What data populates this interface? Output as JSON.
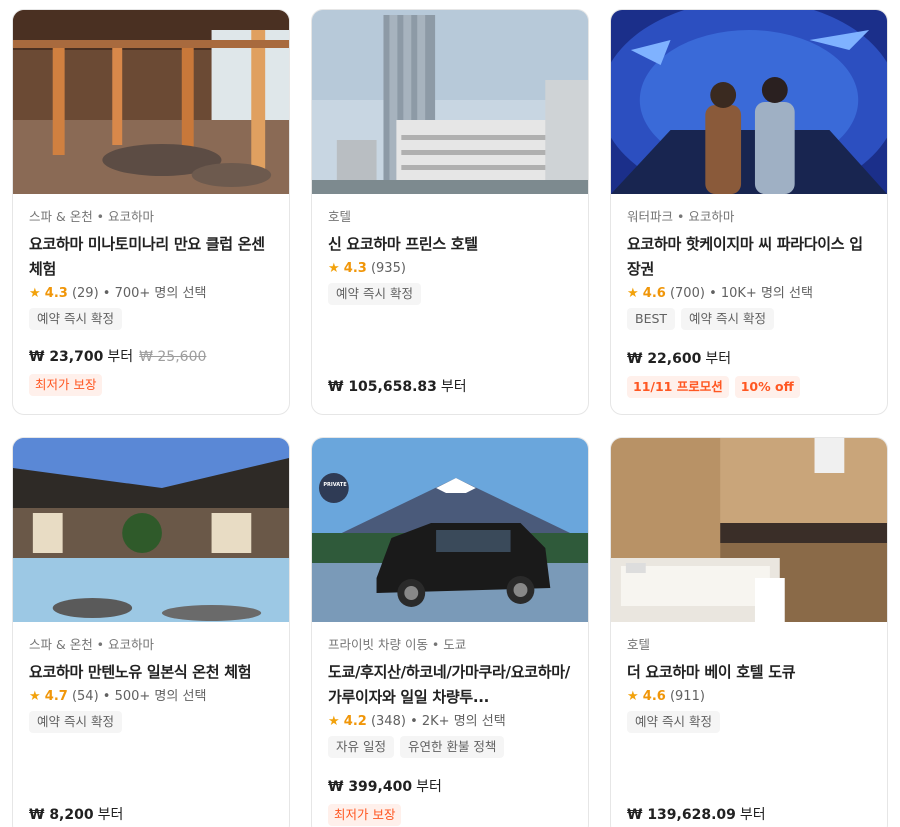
{
  "cards": [
    {
      "category": "스파 & 온천 • 요코하마",
      "title": "요코하마 미나토미나리 만요 클럽 온센 체험",
      "score": "4.3",
      "reviews": "(29)",
      "booked": " • 700+ 명의 선택",
      "tags": [
        "예약 즉시 확정"
      ],
      "price": "₩ 23,700",
      "price_suffix": "부터",
      "original_price": "₩ 25,600",
      "promos": [
        "최저가 보장"
      ]
    },
    {
      "category": "호텔",
      "title": "신 요코하마 프린스 호텔",
      "score": "4.3",
      "reviews": "(935)",
      "booked": "",
      "tags": [
        "예약 즉시 확정"
      ],
      "price": "₩ 105,658.83",
      "price_suffix": "부터",
      "original_price": "",
      "promos": []
    },
    {
      "category": "워터파크 • 요코하마",
      "title": "요코하마 핫케이지마 씨 파라다이스 입장권",
      "score": "4.6",
      "reviews": "(700)",
      "booked": " • 10K+ 명의 선택",
      "tags": [
        "BEST",
        "예약 즉시 확정"
      ],
      "price": "₩ 22,600",
      "price_suffix": "부터",
      "original_price": "",
      "promos": [
        "11/11 프로모션",
        "10% off"
      ]
    },
    {
      "category": "스파 & 온천 • 요코하마",
      "title": "요코하마 만텐노유 일본식 온천 체험",
      "score": "4.7",
      "reviews": "(54)",
      "booked": " • 500+ 명의 선택",
      "tags": [
        "예약 즉시 확정"
      ],
      "price": "₩ 8,200",
      "price_suffix": "부터",
      "original_price": "",
      "promos": []
    },
    {
      "category": "프라이빗 차량 이동 • 도쿄",
      "title": "도쿄/후지산/하코네/가마쿠라/요코하마/가루이자와 일일 차량투...",
      "score": "4.2",
      "reviews": "(348)",
      "booked": " • 2K+ 명의 선택",
      "tags": [
        "자유 일정",
        "유연한 환불 정책"
      ],
      "price": "₩ 399,400",
      "price_suffix": "부터",
      "original_price": "",
      "promos": [
        "최저가 보장"
      ],
      "badge": "PRIVATE"
    },
    {
      "category": "호텔",
      "title": "더 요코하마 베이 호텔 도큐",
      "score": "4.6",
      "reviews": "(911)",
      "booked": "",
      "tags": [
        "예약 즉시 확정"
      ],
      "price": "₩ 139,628.09",
      "price_suffix": "부터",
      "original_price": "",
      "promos": []
    }
  ],
  "icons": {
    "star": "star-icon"
  },
  "colors": {
    "rating": "#f09609",
    "promo_text": "#ff5722",
    "promo_bg": "#fff0eb",
    "tag_bg": "#f5f5f5"
  }
}
